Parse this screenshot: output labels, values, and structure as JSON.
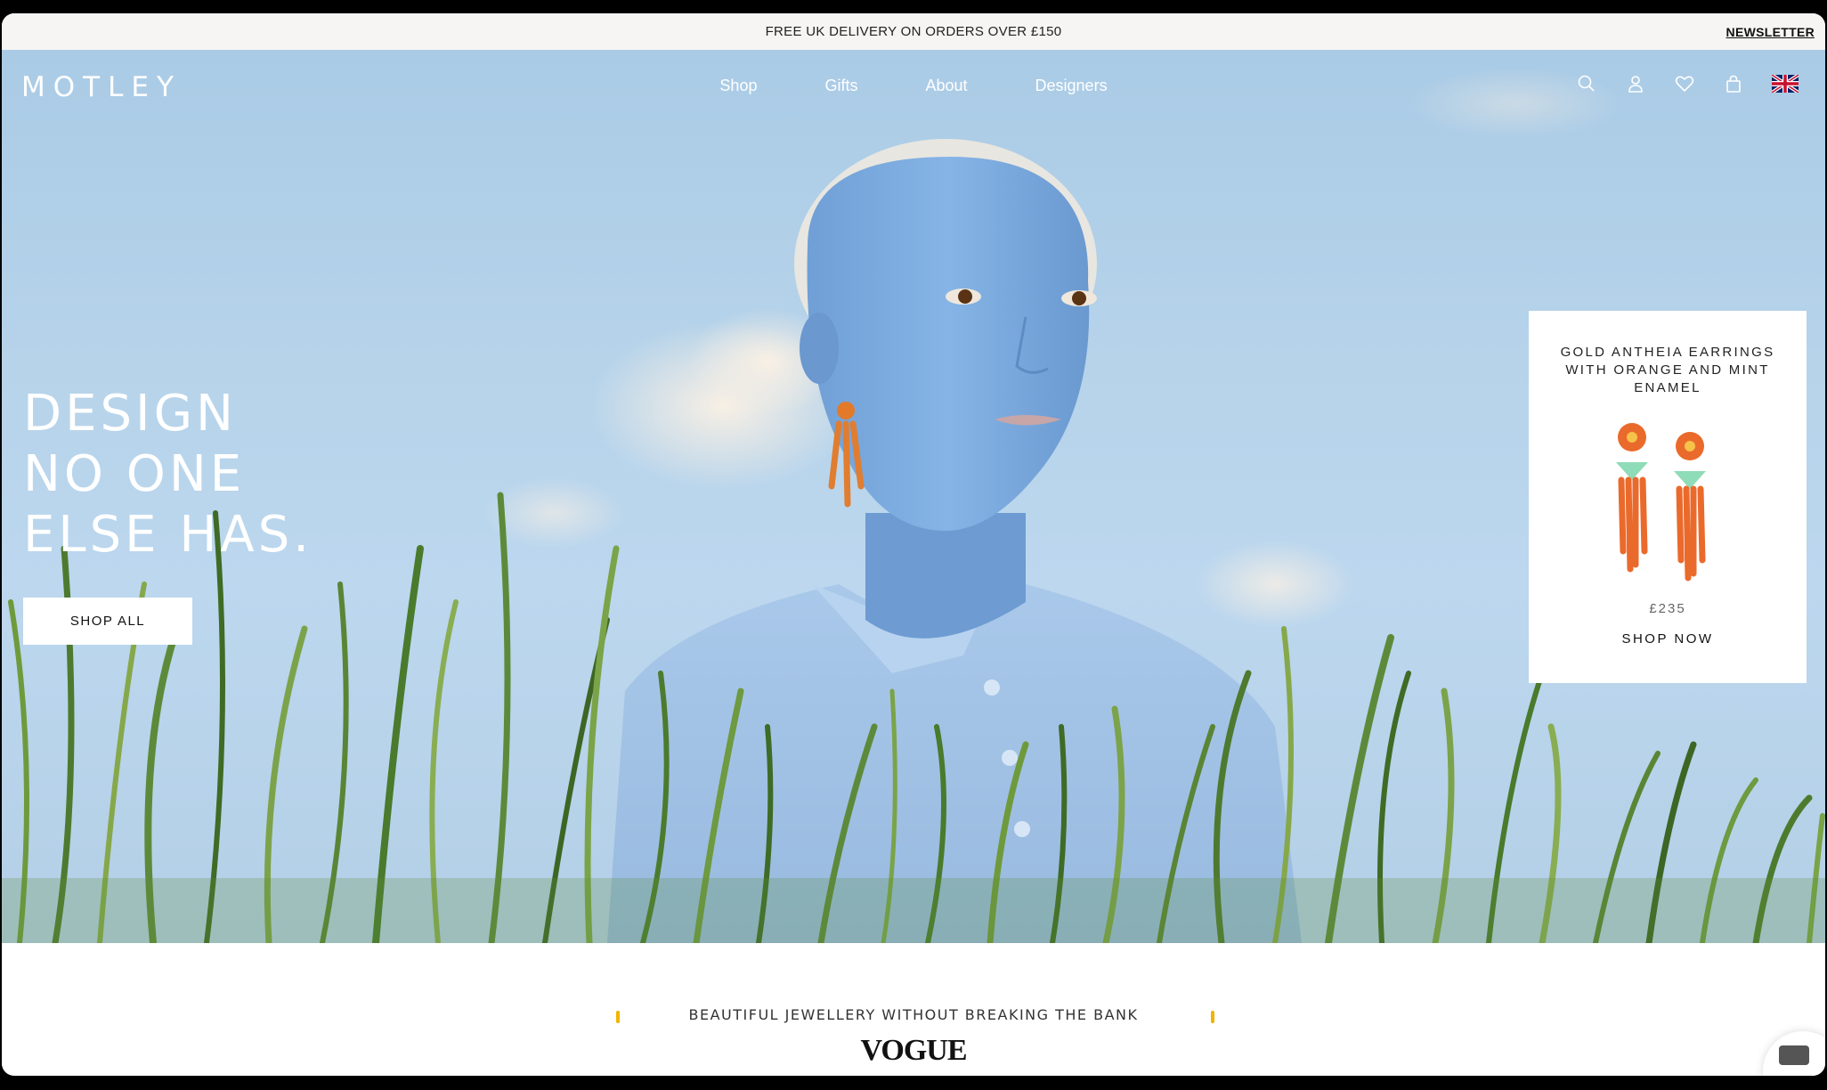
{
  "announcement": {
    "text": "FREE UK DELIVERY ON ORDERS OVER £150",
    "newsletter": "NEWSLETTER"
  },
  "header": {
    "logo": "MOTLEY",
    "nav": [
      "Shop",
      "Gifts",
      "About",
      "Designers"
    ],
    "icons": [
      "search-icon",
      "account-icon",
      "wishlist-heart-icon",
      "bag-icon",
      "uk-flag-icon"
    ]
  },
  "hero": {
    "headline": [
      "DESIGN",
      "NO ONE",
      "ELSE HAS."
    ],
    "cta": "SHOP ALL"
  },
  "product_card": {
    "title": "GOLD ANTHEIA EARRINGS WITH ORANGE AND MINT ENAMEL",
    "price": "£235",
    "cta": "SHOP NOW"
  },
  "press": {
    "quote": "BEAUTIFUL JEWELLERY WITHOUT BREAKING THE BANK",
    "source": "VOGUE"
  },
  "colors": {
    "sky": "#b6d3ea",
    "skin": "#7faedf",
    "grass": "#5d8a3a",
    "quote_mark": "#f0b400"
  }
}
